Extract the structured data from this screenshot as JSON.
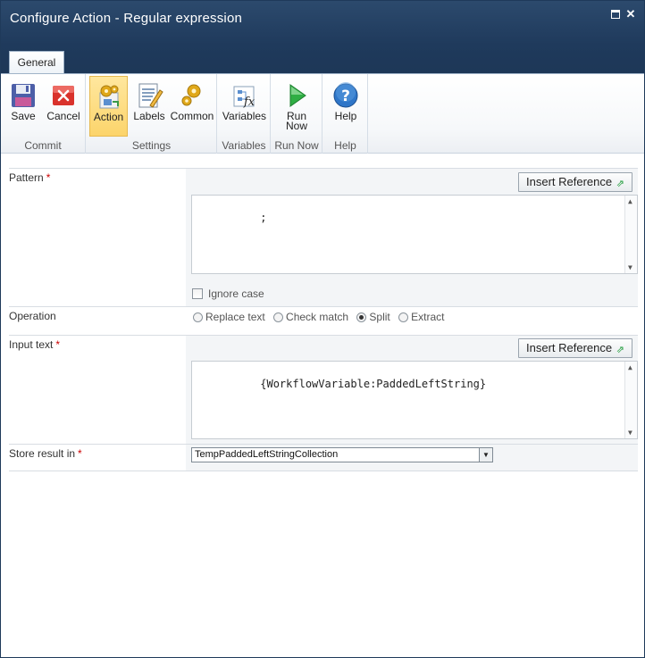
{
  "window": {
    "title": "Configure Action - Regular expression"
  },
  "ribbon": {
    "tab_label": "General",
    "groups": {
      "commit": "Commit",
      "settings": "Settings",
      "variables": "Variables",
      "run_now": "Run Now",
      "help": "Help"
    },
    "buttons": {
      "save": "Save",
      "cancel": "Cancel",
      "action": "Action",
      "labels": "Labels",
      "common": "Common",
      "variables": "Variables",
      "run_now_line1": "Run",
      "run_now_line2": "Now",
      "help": "Help"
    }
  },
  "form": {
    "pattern": {
      "label": "Pattern",
      "required_mark": "*",
      "insert_reference": "Insert Reference",
      "value": ";"
    },
    "ignore_case": {
      "label": "Ignore case",
      "checked": false
    },
    "operation": {
      "label": "Operation",
      "options": [
        "Replace text",
        "Check match",
        "Split",
        "Extract"
      ],
      "selected": "Split"
    },
    "input_text": {
      "label": "Input text",
      "required_mark": "*",
      "insert_reference": "Insert Reference",
      "value": "{WorkflowVariable:PaddedLeftString}"
    },
    "store_result": {
      "label": "Store result in",
      "required_mark": "*",
      "selected": "TempPaddedLeftStringCollection"
    }
  },
  "colors": {
    "titlebar": "#1f3a5c",
    "active_button": "#fcd46b",
    "required": "#cc0000"
  }
}
